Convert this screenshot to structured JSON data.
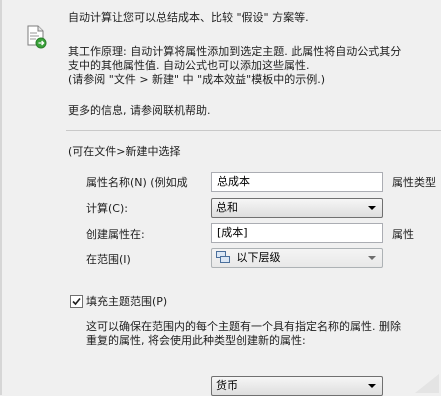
{
  "intro": {
    "description": "自动计算让您可以总结成本、比较 \"假设\" 方案等.",
    "principle_1": "其工作原理: 自动计算将属性添加到选定主题. 此属性将自动公式其分",
    "principle_2": "支中的其他属性值. 自动公式也可以添加这些属性.",
    "principle_3": "(请参阅 \"文件 > 新建\" 中 \"成本效益\"模板中的示例.)",
    "more_info": "更多的信息, 请参阅联机帮助."
  },
  "section": {
    "header": "(可在文件>新建中选择"
  },
  "form": {
    "property_name_label": "属性名称(N) (例如成",
    "property_name_value": "总成本",
    "property_type_label": "属性类型",
    "calculation_label": "计算(C):",
    "calculation_value": "总和",
    "create_in_label": "创建属性在:",
    "create_in_value": "[成本]",
    "create_in_suffix": "属性",
    "scope_label": "在范围(I)",
    "scope_value": "以下层级"
  },
  "fill": {
    "checkbox_label": "填充主题范围(P)",
    "checked": true,
    "desc_1": "这可以确保在范围内的每个主题有一个具有指定名称的属性. 删除",
    "desc_2": "重复的属性, 将会使用此种类型创建新的属性:",
    "type_value": "货币"
  },
  "icons": {
    "document": "document-refresh-icon",
    "scope": "hierarchy-icon",
    "dropdown": "chevron-down-icon",
    "check": "checkmark-icon"
  },
  "colors": {
    "background": "#f0f0f0",
    "text": "#1e1e1e",
    "icon_green": "#3aa23a"
  }
}
